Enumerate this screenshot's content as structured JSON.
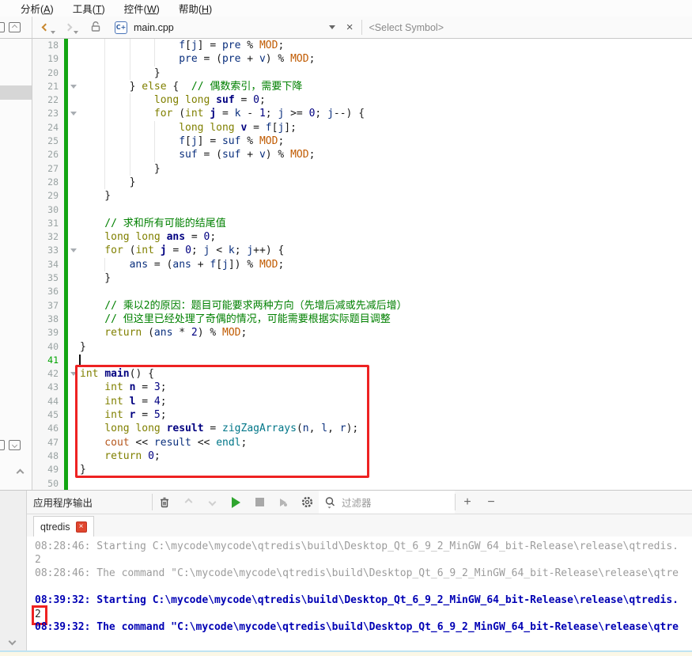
{
  "menu": {
    "items": [
      {
        "pre": "分析(",
        "key": "A",
        "post": ")"
      },
      {
        "pre": "工具(",
        "key": "T",
        "post": ")"
      },
      {
        "pre": "控件(",
        "key": "W",
        "post": ")"
      },
      {
        "pre": "帮助(",
        "key": "H",
        "post": ")"
      }
    ]
  },
  "toolbar": {
    "file_name": "main.cpp",
    "file_icon_label": "C+",
    "symbol_selector": "<Select Symbol>"
  },
  "editor": {
    "lines": [
      {
        "no": "18",
        "ind": 16,
        "t": [
          [
            "v",
            "f"
          ],
          [
            "o",
            "["
          ],
          [
            "v",
            "j"
          ],
          [
            "o",
            "] = "
          ],
          [
            "v",
            "pre"
          ],
          [
            "o",
            " % "
          ],
          [
            "m",
            "MOD"
          ],
          [
            "o",
            ";"
          ]
        ]
      },
      {
        "no": "19",
        "ind": 16,
        "t": [
          [
            "v",
            "pre"
          ],
          [
            "o",
            " = ("
          ],
          [
            "v",
            "pre"
          ],
          [
            "o",
            " + "
          ],
          [
            "v",
            "v"
          ],
          [
            "o",
            ") % "
          ],
          [
            "m",
            "MOD"
          ],
          [
            "o",
            ";"
          ]
        ]
      },
      {
        "no": "20",
        "ind": 12,
        "t": [
          [
            "o",
            "}"
          ]
        ]
      },
      {
        "no": "21",
        "ind": 8,
        "fold": true,
        "t": [
          [
            "o",
            "} "
          ],
          [
            "k",
            "else"
          ],
          [
            "o",
            " {  "
          ],
          [
            "c",
            "// 偶数索引，需要下降"
          ]
        ]
      },
      {
        "no": "22",
        "ind": 12,
        "t": [
          [
            "k",
            "long"
          ],
          [
            "o",
            " "
          ],
          [
            "k",
            "long"
          ],
          [
            "o",
            " "
          ],
          [
            "d",
            "suf"
          ],
          [
            "o",
            " = "
          ],
          [
            "n",
            "0"
          ],
          [
            "o",
            ";"
          ]
        ]
      },
      {
        "no": "23",
        "ind": 12,
        "fold": true,
        "t": [
          [
            "k",
            "for"
          ],
          [
            "o",
            " ("
          ],
          [
            "k",
            "int"
          ],
          [
            "o",
            " "
          ],
          [
            "d",
            "j"
          ],
          [
            "o",
            " = "
          ],
          [
            "v",
            "k"
          ],
          [
            "o",
            " - "
          ],
          [
            "n",
            "1"
          ],
          [
            "o",
            "; "
          ],
          [
            "v",
            "j"
          ],
          [
            "o",
            " >= "
          ],
          [
            "n",
            "0"
          ],
          [
            "o",
            "; "
          ],
          [
            "v",
            "j"
          ],
          [
            "o",
            "--) {"
          ]
        ]
      },
      {
        "no": "24",
        "ind": 16,
        "t": [
          [
            "k",
            "long"
          ],
          [
            "o",
            " "
          ],
          [
            "k",
            "long"
          ],
          [
            "o",
            " "
          ],
          [
            "d",
            "v"
          ],
          [
            "o",
            " = "
          ],
          [
            "v",
            "f"
          ],
          [
            "o",
            "["
          ],
          [
            "v",
            "j"
          ],
          [
            "o",
            "];"
          ]
        ]
      },
      {
        "no": "25",
        "ind": 16,
        "t": [
          [
            "v",
            "f"
          ],
          [
            "o",
            "["
          ],
          [
            "v",
            "j"
          ],
          [
            "o",
            "] = "
          ],
          [
            "v",
            "suf"
          ],
          [
            "o",
            " % "
          ],
          [
            "m",
            "MOD"
          ],
          [
            "o",
            ";"
          ]
        ]
      },
      {
        "no": "26",
        "ind": 16,
        "t": [
          [
            "v",
            "suf"
          ],
          [
            "o",
            " = ("
          ],
          [
            "v",
            "suf"
          ],
          [
            "o",
            " + "
          ],
          [
            "v",
            "v"
          ],
          [
            "o",
            ") % "
          ],
          [
            "m",
            "MOD"
          ],
          [
            "o",
            ";"
          ]
        ]
      },
      {
        "no": "27",
        "ind": 12,
        "t": [
          [
            "o",
            "}"
          ]
        ]
      },
      {
        "no": "28",
        "ind": 8,
        "t": [
          [
            "o",
            "}"
          ]
        ]
      },
      {
        "no": "29",
        "ind": 4,
        "t": [
          [
            "o",
            "}"
          ]
        ]
      },
      {
        "no": "30",
        "t": []
      },
      {
        "no": "31",
        "ind": 4,
        "t": [
          [
            "c",
            "// 求和所有可能的结尾值"
          ]
        ]
      },
      {
        "no": "32",
        "ind": 4,
        "t": [
          [
            "k",
            "long"
          ],
          [
            "o",
            " "
          ],
          [
            "k",
            "long"
          ],
          [
            "o",
            " "
          ],
          [
            "d",
            "ans"
          ],
          [
            "o",
            " = "
          ],
          [
            "n",
            "0"
          ],
          [
            "o",
            ";"
          ]
        ]
      },
      {
        "no": "33",
        "ind": 4,
        "fold": true,
        "t": [
          [
            "k",
            "for"
          ],
          [
            "o",
            " ("
          ],
          [
            "k",
            "int"
          ],
          [
            "o",
            " "
          ],
          [
            "d",
            "j"
          ],
          [
            "o",
            " = "
          ],
          [
            "n",
            "0"
          ],
          [
            "o",
            "; "
          ],
          [
            "v",
            "j"
          ],
          [
            "o",
            " < "
          ],
          [
            "v",
            "k"
          ],
          [
            "o",
            "; "
          ],
          [
            "v",
            "j"
          ],
          [
            "o",
            "++) {"
          ]
        ]
      },
      {
        "no": "34",
        "ind": 8,
        "t": [
          [
            "v",
            "ans"
          ],
          [
            "o",
            " = ("
          ],
          [
            "v",
            "ans"
          ],
          [
            "o",
            " + "
          ],
          [
            "v",
            "f"
          ],
          [
            "o",
            "["
          ],
          [
            "v",
            "j"
          ],
          [
            "o",
            "]) % "
          ],
          [
            "m",
            "MOD"
          ],
          [
            "o",
            ";"
          ]
        ]
      },
      {
        "no": "35",
        "ind": 4,
        "t": [
          [
            "o",
            "}"
          ]
        ]
      },
      {
        "no": "36",
        "t": []
      },
      {
        "no": "37",
        "ind": 4,
        "t": [
          [
            "c",
            "// 乘以2的原因：题目可能要求两种方向（先增后减或先减后增）"
          ]
        ]
      },
      {
        "no": "38",
        "ind": 4,
        "t": [
          [
            "c",
            "// 但这里已经处理了奇偶的情况，可能需要根据实际题目调整"
          ]
        ]
      },
      {
        "no": "39",
        "ind": 4,
        "t": [
          [
            "k",
            "return"
          ],
          [
            "o",
            " ("
          ],
          [
            "v",
            "ans"
          ],
          [
            "o",
            " * "
          ],
          [
            "n",
            "2"
          ],
          [
            "o",
            ") % "
          ],
          [
            "m",
            "MOD"
          ],
          [
            "o",
            ";"
          ]
        ]
      },
      {
        "no": "40",
        "t": [
          [
            "o",
            "}"
          ]
        ]
      },
      {
        "no": "41",
        "green": true,
        "cursor": true,
        "t": []
      },
      {
        "no": "42",
        "fold": true,
        "t": [
          [
            "k",
            "int"
          ],
          [
            "o",
            " "
          ],
          [
            "d",
            "main"
          ],
          [
            "o",
            "() {"
          ]
        ]
      },
      {
        "no": "43",
        "ind": 4,
        "t": [
          [
            "k",
            "int"
          ],
          [
            "o",
            " "
          ],
          [
            "d",
            "n"
          ],
          [
            "o",
            " = "
          ],
          [
            "n",
            "3"
          ],
          [
            "o",
            ";"
          ]
        ]
      },
      {
        "no": "44",
        "ind": 4,
        "t": [
          [
            "k",
            "int"
          ],
          [
            "o",
            " "
          ],
          [
            "d",
            "l"
          ],
          [
            "o",
            " = "
          ],
          [
            "n",
            "4"
          ],
          [
            "o",
            ";"
          ]
        ]
      },
      {
        "no": "45",
        "ind": 4,
        "t": [
          [
            "k",
            "int"
          ],
          [
            "o",
            " "
          ],
          [
            "d",
            "r"
          ],
          [
            "o",
            " = "
          ],
          [
            "n",
            "5"
          ],
          [
            "o",
            ";"
          ]
        ]
      },
      {
        "no": "46",
        "ind": 4,
        "t": [
          [
            "k",
            "long"
          ],
          [
            "o",
            " "
          ],
          [
            "k",
            "long"
          ],
          [
            "o",
            " "
          ],
          [
            "d",
            "result"
          ],
          [
            "o",
            " = "
          ],
          [
            "f",
            "zigZagArrays"
          ],
          [
            "o",
            "("
          ],
          [
            "v",
            "n"
          ],
          [
            "o",
            ", "
          ],
          [
            "v",
            "l"
          ],
          [
            "o",
            ", "
          ],
          [
            "v",
            "r"
          ],
          [
            "o",
            ");"
          ]
        ]
      },
      {
        "no": "47",
        "ind": 4,
        "t": [
          [
            "g",
            "cout"
          ],
          [
            "o",
            " << "
          ],
          [
            "v",
            "result"
          ],
          [
            "o",
            " << "
          ],
          [
            "f",
            "endl"
          ],
          [
            "o",
            ";"
          ]
        ]
      },
      {
        "no": "48",
        "ind": 4,
        "t": [
          [
            "k",
            "return"
          ],
          [
            "o",
            " "
          ],
          [
            "n",
            "0"
          ],
          [
            "o",
            ";"
          ]
        ]
      },
      {
        "no": "49",
        "t": [
          [
            "o",
            "}"
          ]
        ]
      },
      {
        "no": "50",
        "t": []
      }
    ]
  },
  "output": {
    "title": "应用程序输出",
    "filter_placeholder": "过滤器",
    "zoom_in": "+",
    "zoom_out": "−",
    "tab": {
      "label": "qtredis"
    },
    "lines": [
      {
        "cls": "gray",
        "text": "08:28:46: Starting C:\\mycode\\mycode\\qtredis\\build\\Desktop_Qt_6_9_2_MinGW_64_bit-Release\\release\\qtredis."
      },
      {
        "cls": "gray",
        "text": "2"
      },
      {
        "cls": "gray",
        "text": "08:28:46: The command \"C:\\mycode\\mycode\\qtredis\\build\\Desktop_Qt_6_9_2_MinGW_64_bit-Release\\release\\qtre"
      },
      {
        "cls": "gray",
        "text": ""
      },
      {
        "cls": "blue",
        "text": "08:39:32: Starting C:\\mycode\\mycode\\qtredis\\build\\Desktop_Qt_6_9_2_MinGW_64_bit-Release\\release\\qtredis."
      },
      {
        "cls": "dark",
        "text": "2",
        "boxed": true
      },
      {
        "cls": "blue",
        "text": "08:39:32: The command \"C:\\mycode\\mycode\\qtredis\\build\\Desktop_Qt_6_9_2_MinGW_64_bit-Release\\release\\qtre"
      }
    ]
  }
}
